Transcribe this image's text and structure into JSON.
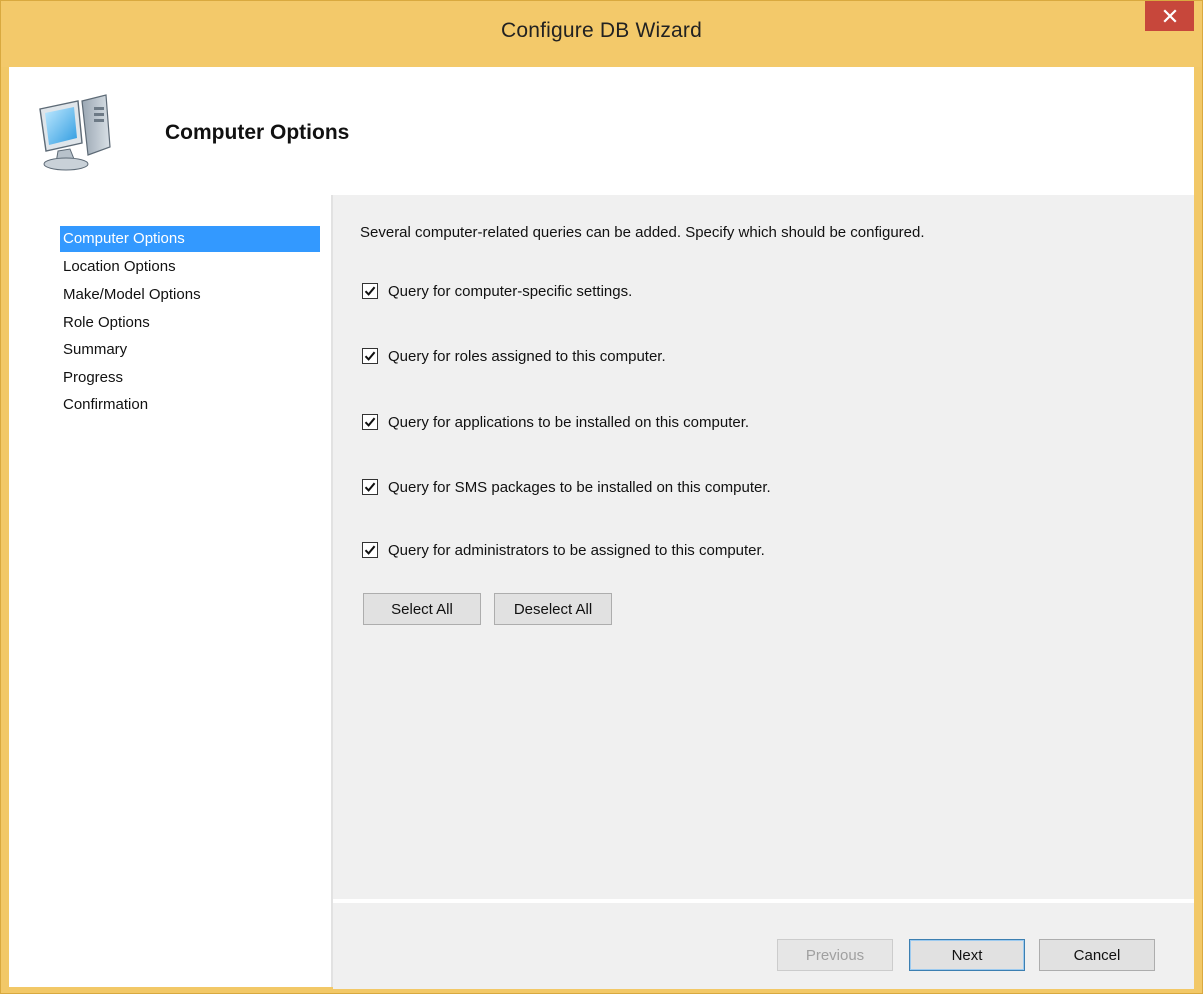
{
  "window": {
    "title": "Configure DB Wizard",
    "close_icon": "close-icon"
  },
  "header": {
    "icon": "computer-icon",
    "title": "Computer Options"
  },
  "sidebar": {
    "items": [
      {
        "label": "Computer Options",
        "active": true
      },
      {
        "label": "Location Options",
        "active": false
      },
      {
        "label": "Make/Model Options",
        "active": false
      },
      {
        "label": "Role Options",
        "active": false
      },
      {
        "label": "Summary",
        "active": false
      },
      {
        "label": "Progress",
        "active": false
      },
      {
        "label": "Confirmation",
        "active": false
      }
    ]
  },
  "main": {
    "intro": "Several computer-related queries can be added. Specify which should be configured.",
    "options": [
      {
        "label": "Query for computer-specific settings.",
        "checked": true
      },
      {
        "label": "Query for roles assigned to this computer.",
        "checked": true
      },
      {
        "label": "Query for applications to be installed on this computer.",
        "checked": true
      },
      {
        "label": "Query for SMS packages to be installed on this computer.",
        "checked": true
      },
      {
        "label": "Query for administrators to be assigned to this computer.",
        "checked": true
      }
    ],
    "select_all_label": "Select All",
    "deselect_all_label": "Deselect All"
  },
  "footer": {
    "previous_label": "Previous",
    "previous_enabled": false,
    "next_label": "Next",
    "cancel_label": "Cancel"
  },
  "colors": {
    "titlebar": "#f3c96a",
    "close_button": "#c7473b",
    "selection": "#3399ff",
    "panel": "#f0f0f0"
  }
}
